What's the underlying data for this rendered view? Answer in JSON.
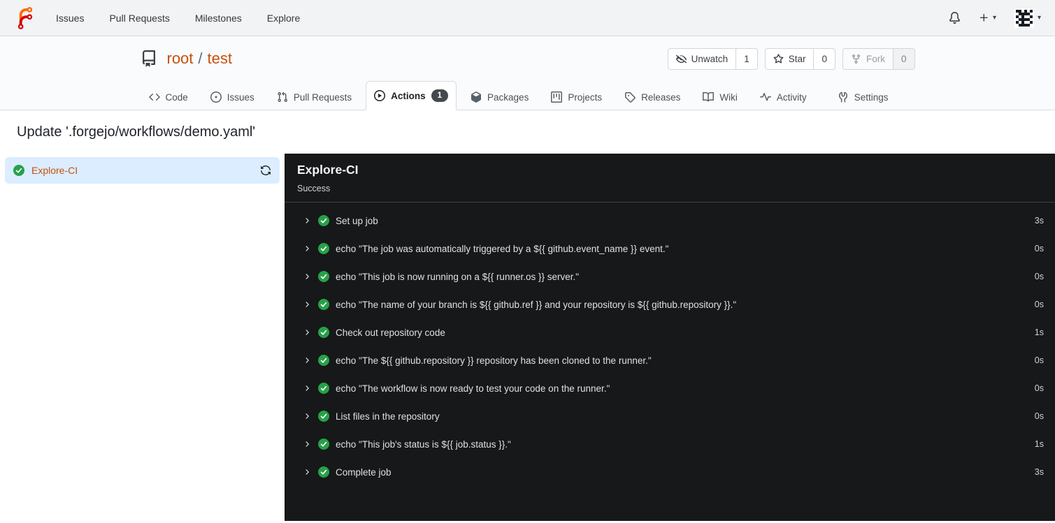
{
  "navbar": {
    "items": [
      {
        "label": "Issues"
      },
      {
        "label": "Pull Requests"
      },
      {
        "label": "Milestones"
      },
      {
        "label": "Explore"
      }
    ],
    "icons": [
      "bell-icon",
      "plus-icon",
      "avatar-identicon"
    ]
  },
  "repo": {
    "owner": "root",
    "separator": "/",
    "name": "test",
    "actions": [
      {
        "label": "Unwatch",
        "count": "1",
        "icon": "eye-slash-icon"
      },
      {
        "label": "Star",
        "count": "0",
        "icon": "star-icon"
      },
      {
        "label": "Fork",
        "count": "0",
        "icon": "fork-icon",
        "disabled": true
      }
    ]
  },
  "tabs": {
    "items": [
      {
        "label": "Code",
        "icon": "code-icon"
      },
      {
        "label": "Issues",
        "icon": "issue-icon"
      },
      {
        "label": "Pull Requests",
        "icon": "pull-request-icon"
      },
      {
        "label": "Actions",
        "icon": "play-circle-icon",
        "badge": "1",
        "active": true
      },
      {
        "label": "Packages",
        "icon": "package-icon"
      },
      {
        "label": "Projects",
        "icon": "project-icon"
      },
      {
        "label": "Releases",
        "icon": "tag-icon"
      },
      {
        "label": "Wiki",
        "icon": "book-icon"
      },
      {
        "label": "Activity",
        "icon": "pulse-icon"
      },
      {
        "label": "Settings",
        "icon": "wrench-icon"
      }
    ]
  },
  "run": {
    "title": "Update '.forgejo/workflows/demo.yaml'",
    "job": {
      "name": "Explore-CI",
      "status": "success"
    },
    "panel": {
      "title": "Explore-CI",
      "status": "Success"
    },
    "steps": [
      {
        "name": "Set up job",
        "duration": "3s"
      },
      {
        "name": "echo \"The job was automatically triggered by a ${{ github.event_name }} event.\"",
        "duration": "0s"
      },
      {
        "name": "echo \"This job is now running on a ${{ runner.os }} server.\"",
        "duration": "0s"
      },
      {
        "name": "echo \"The name of your branch is ${{ github.ref }} and your repository is ${{ github.repository }}.\"",
        "duration": "0s"
      },
      {
        "name": "Check out repository code",
        "duration": "1s"
      },
      {
        "name": "echo \"The ${{ github.repository }} repository has been cloned to the runner.\"",
        "duration": "0s"
      },
      {
        "name": "echo \"The workflow is now ready to test your code on the runner.\"",
        "duration": "0s"
      },
      {
        "name": "List files in the repository",
        "duration": "0s"
      },
      {
        "name": "echo \"This job's status is ${{ job.status }}.\"",
        "duration": "1s"
      },
      {
        "name": "Complete job",
        "duration": "3s"
      }
    ]
  },
  "colors": {
    "accent_orange": "#c6510f",
    "success_green": "#26a148",
    "dark_panel_bg": "#171819",
    "active_job_bg": "#dbedff",
    "badge_bg": "#45494f"
  }
}
